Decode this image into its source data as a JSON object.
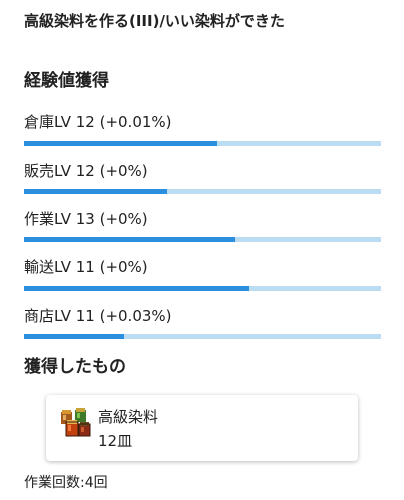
{
  "header": {
    "title": "高級染料を作る(III)/いい染料ができた"
  },
  "experience": {
    "heading": "経験値獲得",
    "stats": [
      {
        "label": "倉庫LV 12 (+0.01%)",
        "progress": 0.54
      },
      {
        "label": "販売LV 12 (+0%)",
        "progress": 0.4
      },
      {
        "label": "作業LV 13 (+0%)",
        "progress": 0.59
      },
      {
        "label": "輸送LV 11 (+0%)",
        "progress": 0.63
      },
      {
        "label": "商店LV 11 (+0.03%)",
        "progress": 0.28
      }
    ]
  },
  "obtained": {
    "heading": "獲得したもの",
    "items": [
      {
        "name": "高級染料",
        "quantity": "12皿",
        "icon": "dye-jars-icon"
      }
    ]
  },
  "footer": {
    "work_count": "作業回数:4回"
  },
  "colors": {
    "bar_fill": "#2b8fe0",
    "bar_track": "#bcdcf4"
  }
}
